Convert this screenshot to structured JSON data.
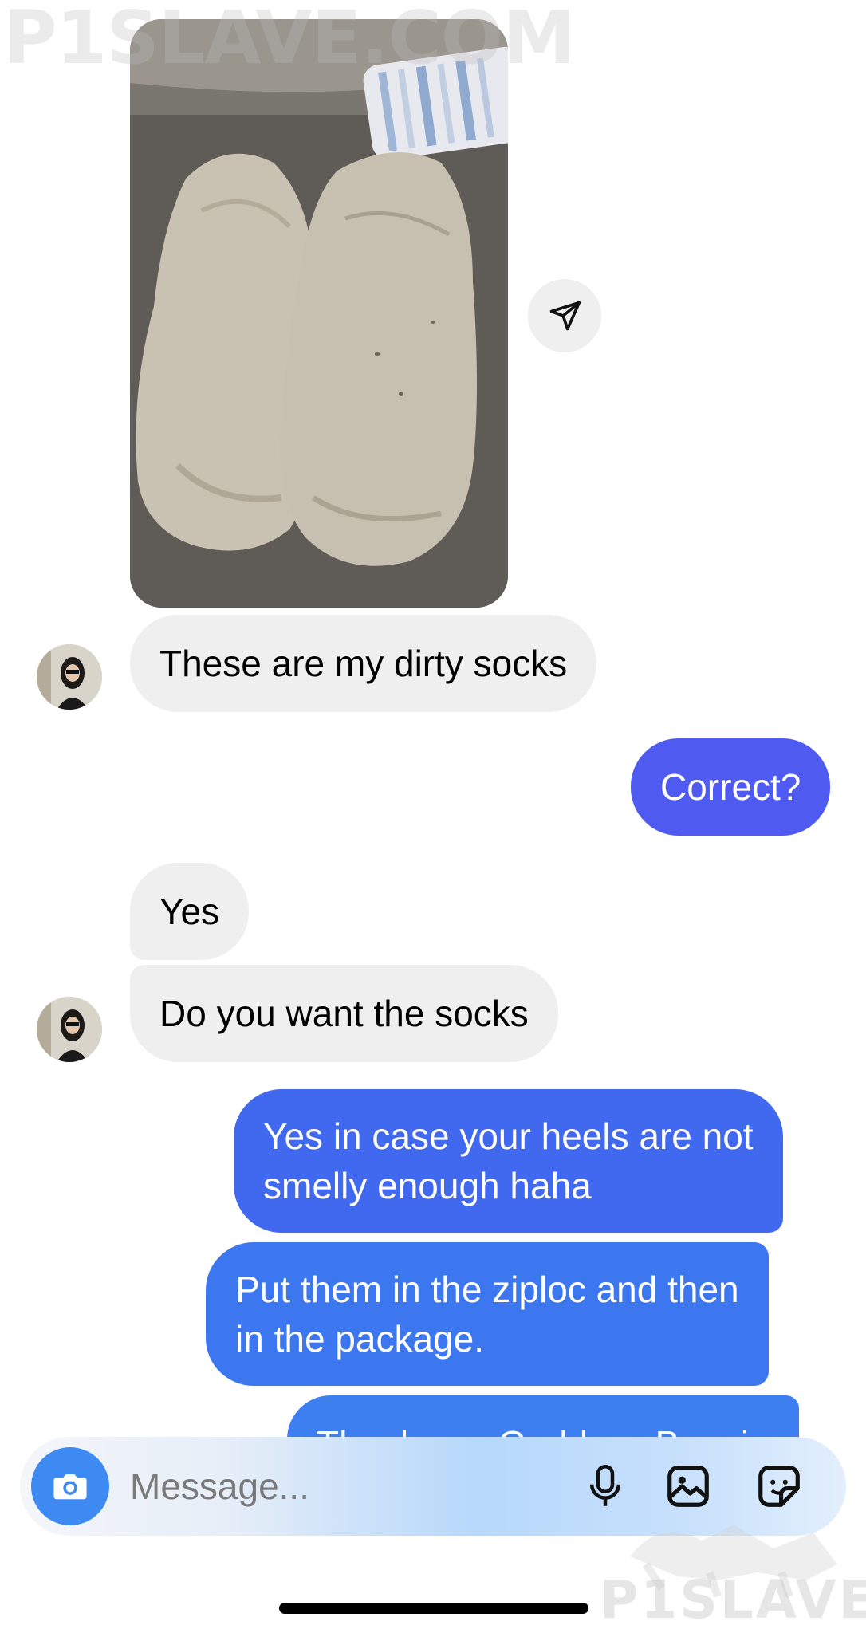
{
  "watermark": {
    "top_text": "P1SLAVE.COM",
    "bottom_text": "P1SLAVE"
  },
  "messages": [
    {
      "id": "m1",
      "side": "incoming",
      "text": "These are my dirty socks"
    },
    {
      "id": "m2",
      "side": "outgoing",
      "text": "Correct?"
    },
    {
      "id": "m3",
      "side": "incoming",
      "text": "Yes"
    },
    {
      "id": "m4",
      "side": "incoming",
      "text": "Do you want the socks"
    },
    {
      "id": "m5",
      "side": "outgoing",
      "lines": [
        "Yes in case your heels are not",
        "smelly enough haha"
      ]
    },
    {
      "id": "m6",
      "side": "outgoing",
      "lines": [
        "Put them in the ziploc and then",
        "in the package."
      ]
    },
    {
      "id": "m7",
      "side": "outgoing",
      "text": "Thank you Goddess Bonnie"
    }
  ],
  "composer": {
    "placeholder": "Message...",
    "icons": [
      "camera-icon",
      "microphone-icon",
      "gallery-icon",
      "sticker-icon"
    ]
  },
  "colors": {
    "incoming_bubble": "#efefef",
    "outgoing_top": "#4f5bf0",
    "outgoing_bottom": "#3d7ff0",
    "camera_button": "#3d8bf2"
  }
}
